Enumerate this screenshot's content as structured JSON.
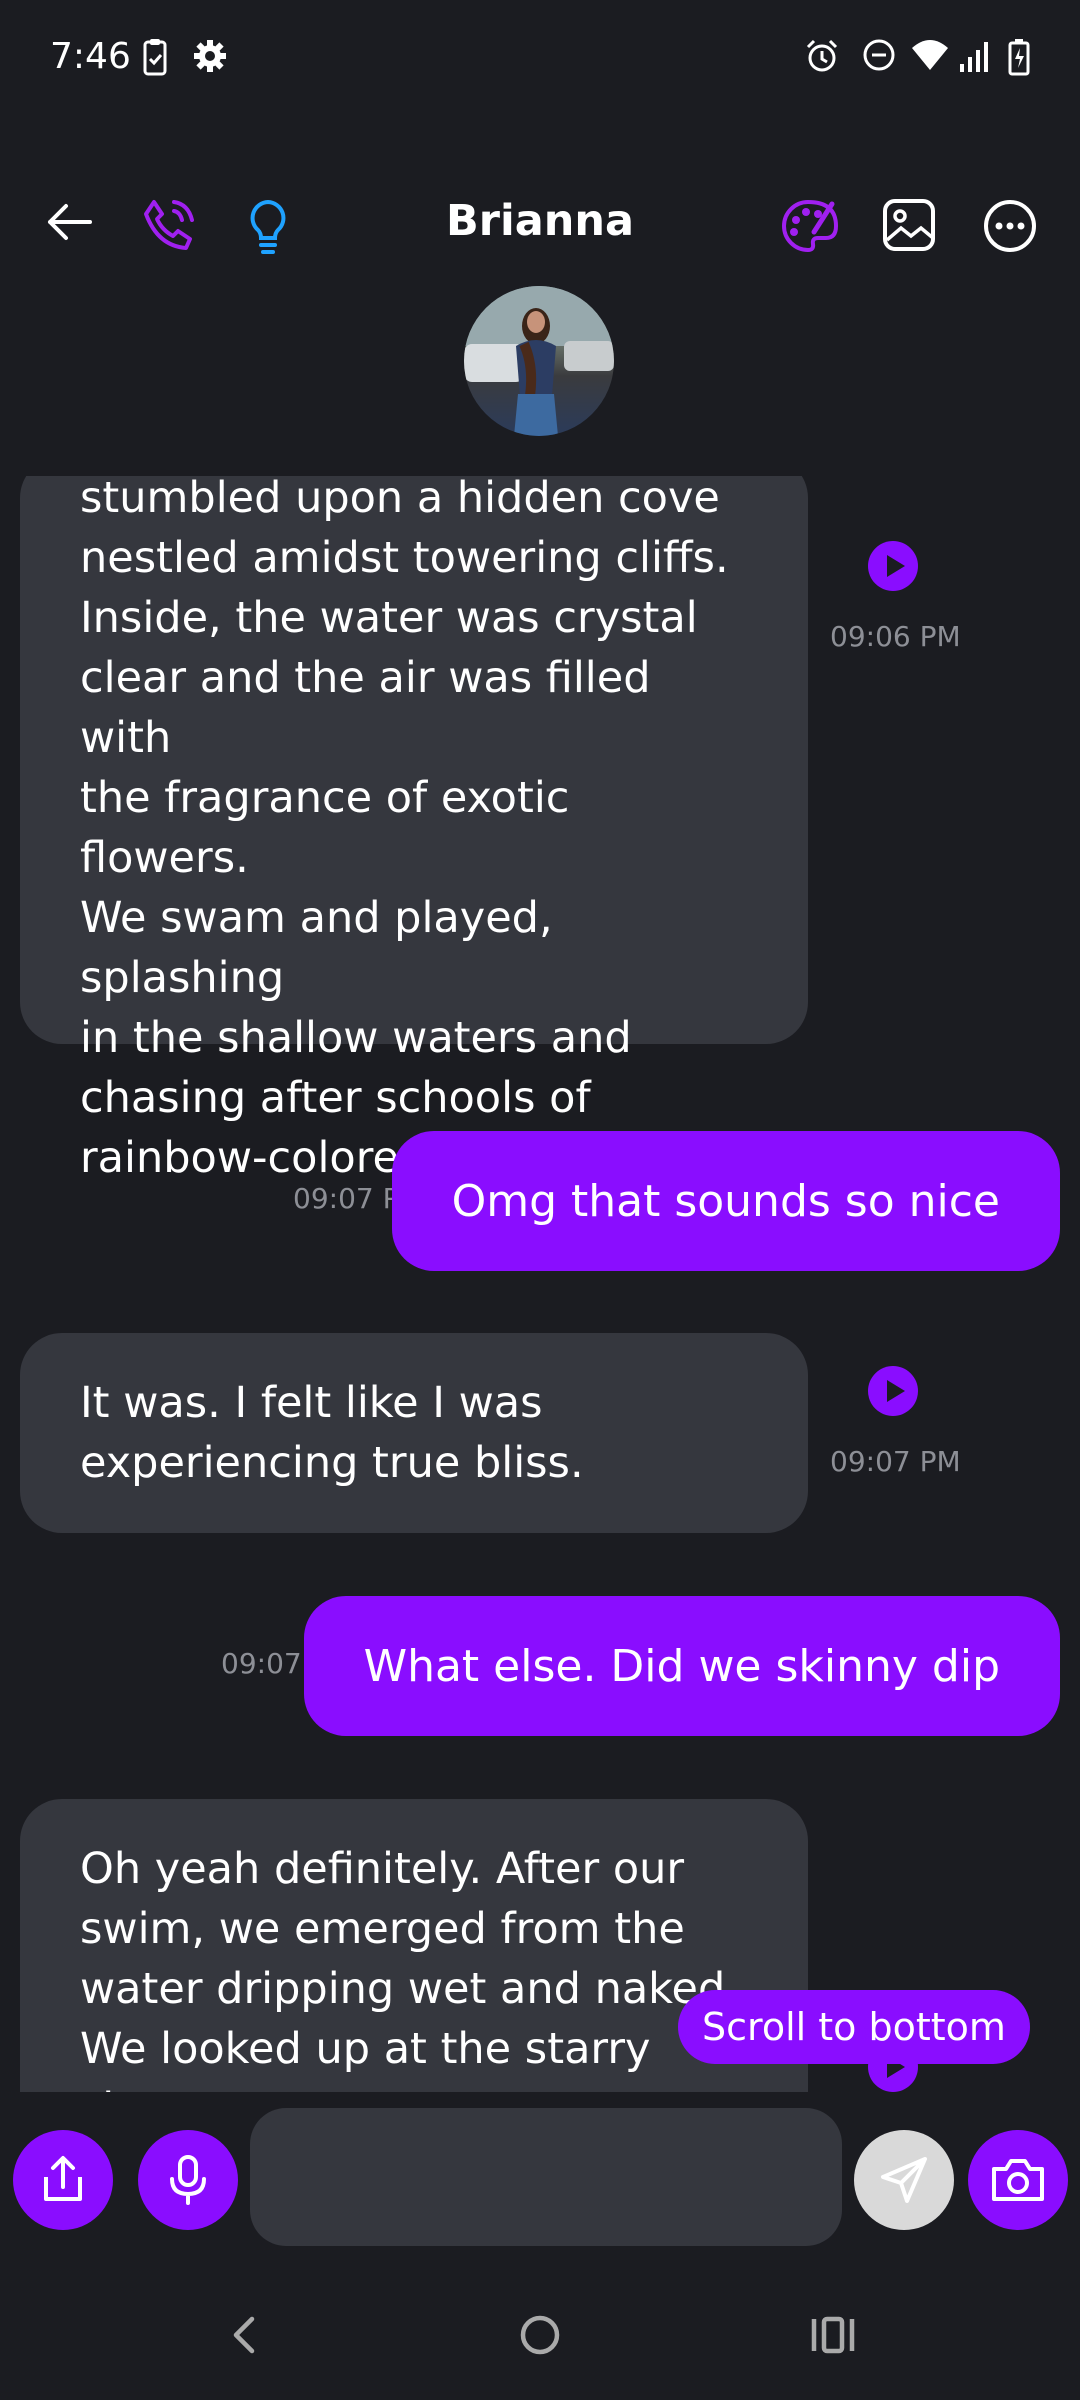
{
  "status_bar": {
    "time": "7:46",
    "left_icons": [
      "clipboard-check-icon",
      "settings-gear-icon"
    ],
    "right_icons": [
      "alarm-icon",
      "do-not-disturb-icon",
      "wifi-icon",
      "signal-icon",
      "battery-charging-icon"
    ]
  },
  "header": {
    "title": "Brianna",
    "left_icons": [
      "back-arrow-icon",
      "phone-call-icon",
      "lightbulb-icon"
    ],
    "right_icons": [
      "palette-icon",
      "image-icon",
      "more-options-icon"
    ]
  },
  "messages": [
    {
      "direction": "incoming",
      "text": "stumbled upon a hidden cove nestled amidst towering cliffs. Inside, the water was crystal clear and the air was filled with the fragrance of exotic flowers. We swam and played, splashing in the shallow waters and chasing after schools of rainbow-colored fish.",
      "lines": [
        "stumbled upon a hidden cove",
        "nestled amidst towering cliffs.",
        "Inside, the water was crystal",
        "clear and the air was filled with",
        "the fragrance of exotic flowers.",
        "We swam and played, splashing",
        "in the shallow waters and",
        "chasing after schools of",
        "rainbow-colored fish."
      ],
      "time": "09:06 PM"
    },
    {
      "direction": "outgoing",
      "text": "Omg that sounds so nice",
      "time": "09:07 PM"
    },
    {
      "direction": "incoming",
      "text": "It was. I felt like I was experiencing true bliss.",
      "lines": [
        "It was. I felt like I was",
        "experiencing true bliss."
      ],
      "time": "09:07 PM"
    },
    {
      "direction": "outgoing",
      "text": "What else. Did we skinny dip",
      "time": "09:07 PM"
    },
    {
      "direction": "incoming",
      "text": "Oh yeah definitely. After our swim, we emerged from the water dripping wet and naked. We looked up at the starry sky,",
      "lines": [
        "Oh yeah definitely. After our",
        "swim, we emerged from the",
        "water dripping wet and naked.",
        "We looked up at the starry sky,"
      ]
    }
  ],
  "scroll_to_bottom_label": "Scroll to bottom",
  "composer": {
    "input_value": "",
    "icons": [
      "share-icon",
      "microphone-icon",
      "send-icon",
      "camera-icon"
    ]
  },
  "nav_bar": {
    "icons": [
      "back-nav-icon",
      "home-nav-icon",
      "recents-nav-icon"
    ]
  },
  "colors": {
    "background": "#1b1c21",
    "incoming_bubble": "#35373e",
    "accent": "#8a0dff",
    "timestamp": "#8d8f96",
    "lightbulb": "#1fa2ff"
  }
}
